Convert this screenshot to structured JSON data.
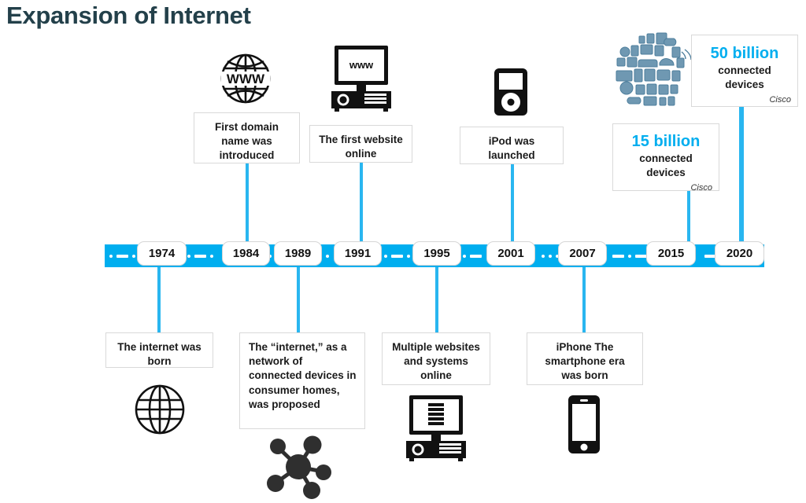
{
  "page": {
    "title": "Expansion of Internet",
    "title_color": "#23404a",
    "accent_color": "#00aeef",
    "background": "#ffffff"
  },
  "timeline": {
    "bar_color": "#00aeef",
    "years": [
      {
        "label": "1974"
      },
      {
        "label": "1984"
      },
      {
        "label": "1989"
      },
      {
        "label": "1991"
      },
      {
        "label": "1995"
      },
      {
        "label": "2001"
      },
      {
        "label": "2007"
      },
      {
        "label": "2015"
      },
      {
        "label": "2020"
      }
    ]
  },
  "callouts": {
    "above": [
      {
        "year": "1984",
        "text": "First domain name was introduced",
        "icon": "www-globe-icon"
      },
      {
        "year": "1991",
        "text": "The first website online",
        "icon": "desktop-www-icon"
      },
      {
        "year": "2001",
        "text": "iPod was launched",
        "icon": "ipod-icon"
      },
      {
        "year": "2015",
        "stat_number": "15 billion",
        "stat_body": "connected devices",
        "source": "Cisco"
      },
      {
        "year": "2020",
        "stat_number": "50 billion",
        "stat_body": "connected devices",
        "source": "Cisco",
        "icon": "iot-cluster-icon"
      }
    ],
    "below": [
      {
        "year": "1974",
        "text": "The internet was born",
        "icon": "globe-icon"
      },
      {
        "year": "1989",
        "text": "The “internet,” as a network of connected devices in consumer homes, was proposed",
        "icon": "network-nodes-icon"
      },
      {
        "year": "1995",
        "text": "Multiple websites and systems online",
        "icon": "desktop-list-icon"
      },
      {
        "year": "2007",
        "text": "iPhone The smartphone era was born",
        "icon": "smartphone-icon"
      }
    ]
  },
  "icon_labels": {
    "www_globe": "WWW",
    "monitor_screen": "www"
  }
}
